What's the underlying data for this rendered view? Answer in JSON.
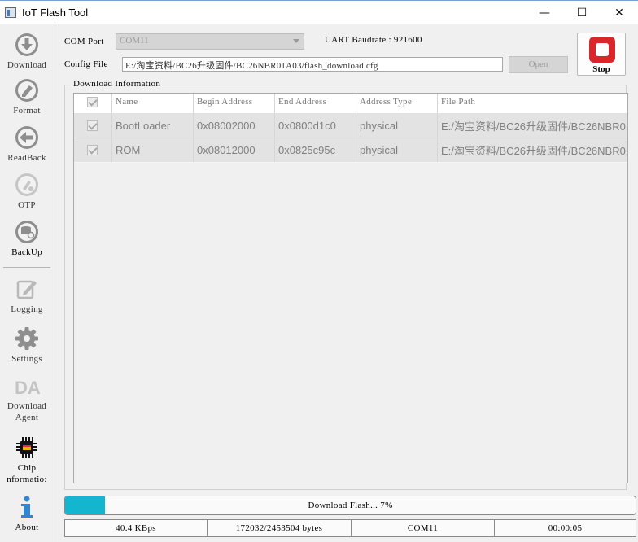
{
  "window": {
    "title": "IoT Flash Tool",
    "minimize": "—",
    "maximize": "☐",
    "close": "✕"
  },
  "sidebar": {
    "items": [
      {
        "label": "Download",
        "icon": "download-icon"
      },
      {
        "label": "Format",
        "icon": "format-icon"
      },
      {
        "label": "ReadBack",
        "icon": "readback-icon"
      },
      {
        "label": "OTP",
        "icon": "otp-icon"
      },
      {
        "label": "BackUp",
        "icon": "backup-icon"
      },
      {
        "label": "Logging",
        "icon": "logging-icon"
      },
      {
        "label": "Settings",
        "icon": "gear-icon"
      },
      {
        "label": "Download",
        "label2": "Agent",
        "icon_text": "DA",
        "icon": "download-agent-icon"
      },
      {
        "label": "Chip",
        "label2": "nformatio:",
        "icon": "chip-icon"
      },
      {
        "label": "About",
        "icon": "info-icon"
      }
    ]
  },
  "controls": {
    "com_port_label": "COM Port",
    "com_port_value": "COM11",
    "baud_label": "UART Baudrate : 921600",
    "config_label": "Config File",
    "config_value": "E:/淘宝资料/BC26升级固件/BC26NBR01A03/flash_download.cfg",
    "open_label": "Open",
    "stop_label": "Stop"
  },
  "download_info": {
    "title": "Download Information",
    "columns": [
      "",
      "Name",
      "Begin Address",
      "End Address",
      "Address Type",
      "File Path"
    ],
    "rows": [
      {
        "name": "BootLoader",
        "begin": "0x08002000",
        "end": "0x0800d1c0",
        "type": "physical",
        "path": "E:/淘宝资料/BC26升级固件/BC26NBR0..."
      },
      {
        "name": "ROM",
        "begin": "0x08012000",
        "end": "0x0825c95c",
        "type": "physical",
        "path": "E:/淘宝资料/BC26升级固件/BC26NBR0..."
      }
    ]
  },
  "progress": {
    "text": "Download Flash... 7%",
    "percent": 7,
    "color": "#14b6cf"
  },
  "status": {
    "speed": "40.4 KBps",
    "bytes": "172032/2453504 bytes",
    "port": "COM11",
    "elapsed": "00:00:05"
  },
  "colors": {
    "stop": "#d9262c",
    "accent": "#14b6cf"
  }
}
